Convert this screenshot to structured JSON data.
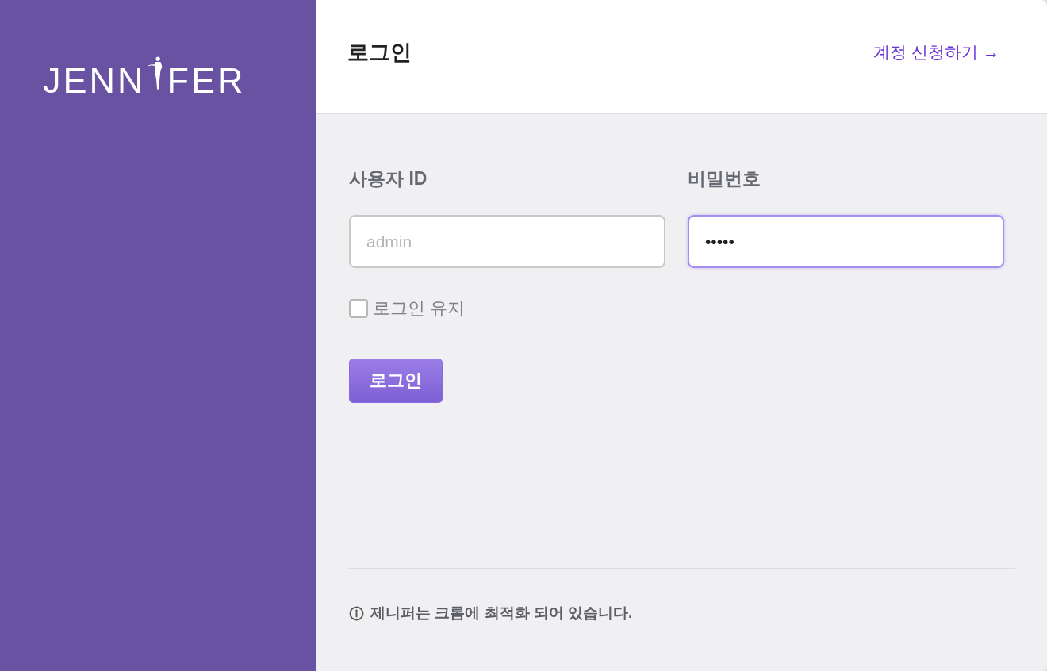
{
  "logo": {
    "before": "JENN",
    "after": "FER"
  },
  "header": {
    "title": "로그인",
    "signup_link": "계정 신청하기 →"
  },
  "fields": [
    {
      "label": "사용자 ID",
      "placeholder": "admin",
      "focused": false
    },
    {
      "label": "비밀번호",
      "value": "•••••",
      "focused": true
    }
  ],
  "remember": {
    "label": "로그인 유지",
    "checked": false
  },
  "login_button": "로그인",
  "notice": "제니퍼는 크롬에 최적화 되어 있습니다."
}
